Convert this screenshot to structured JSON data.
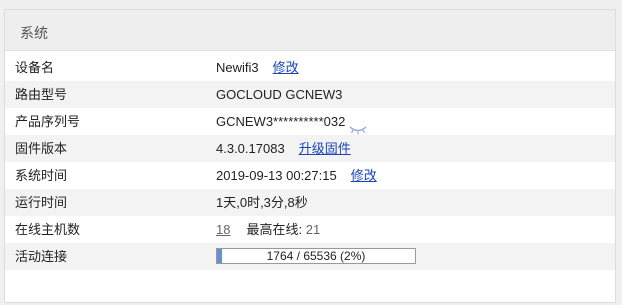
{
  "panel": {
    "title": "系统"
  },
  "rows": {
    "device_name": {
      "label": "设备名",
      "value": "Newifi3",
      "action": "修改"
    },
    "router_model": {
      "label": "路由型号",
      "value": "GOCLOUD GCNEW3"
    },
    "serial": {
      "label": "产品序列号",
      "value": "GCNEW3**********032",
      "icon": "eye-closed-icon"
    },
    "firmware": {
      "label": "固件版本",
      "value": "4.3.0.17083",
      "action": "升级固件"
    },
    "system_time": {
      "label": "系统时间",
      "value": "2019-09-13 00:27:15",
      "action": "修改"
    },
    "uptime": {
      "label": "运行时间",
      "value": "1天,0时,3分,8秒"
    },
    "online_hosts": {
      "label": "在线主机数",
      "count": "18",
      "max_label": "最高在线:",
      "max_value": "21"
    },
    "active_connections": {
      "label": "活动连接",
      "text": "1764 / 65536 (2%)",
      "percent": 2.7
    }
  },
  "colors": {
    "link": "#1a44b8",
    "row_alt_bg": "#f3f3f3",
    "header_bg": "#eeeeee",
    "progress_fill": "#6a8fcf"
  }
}
